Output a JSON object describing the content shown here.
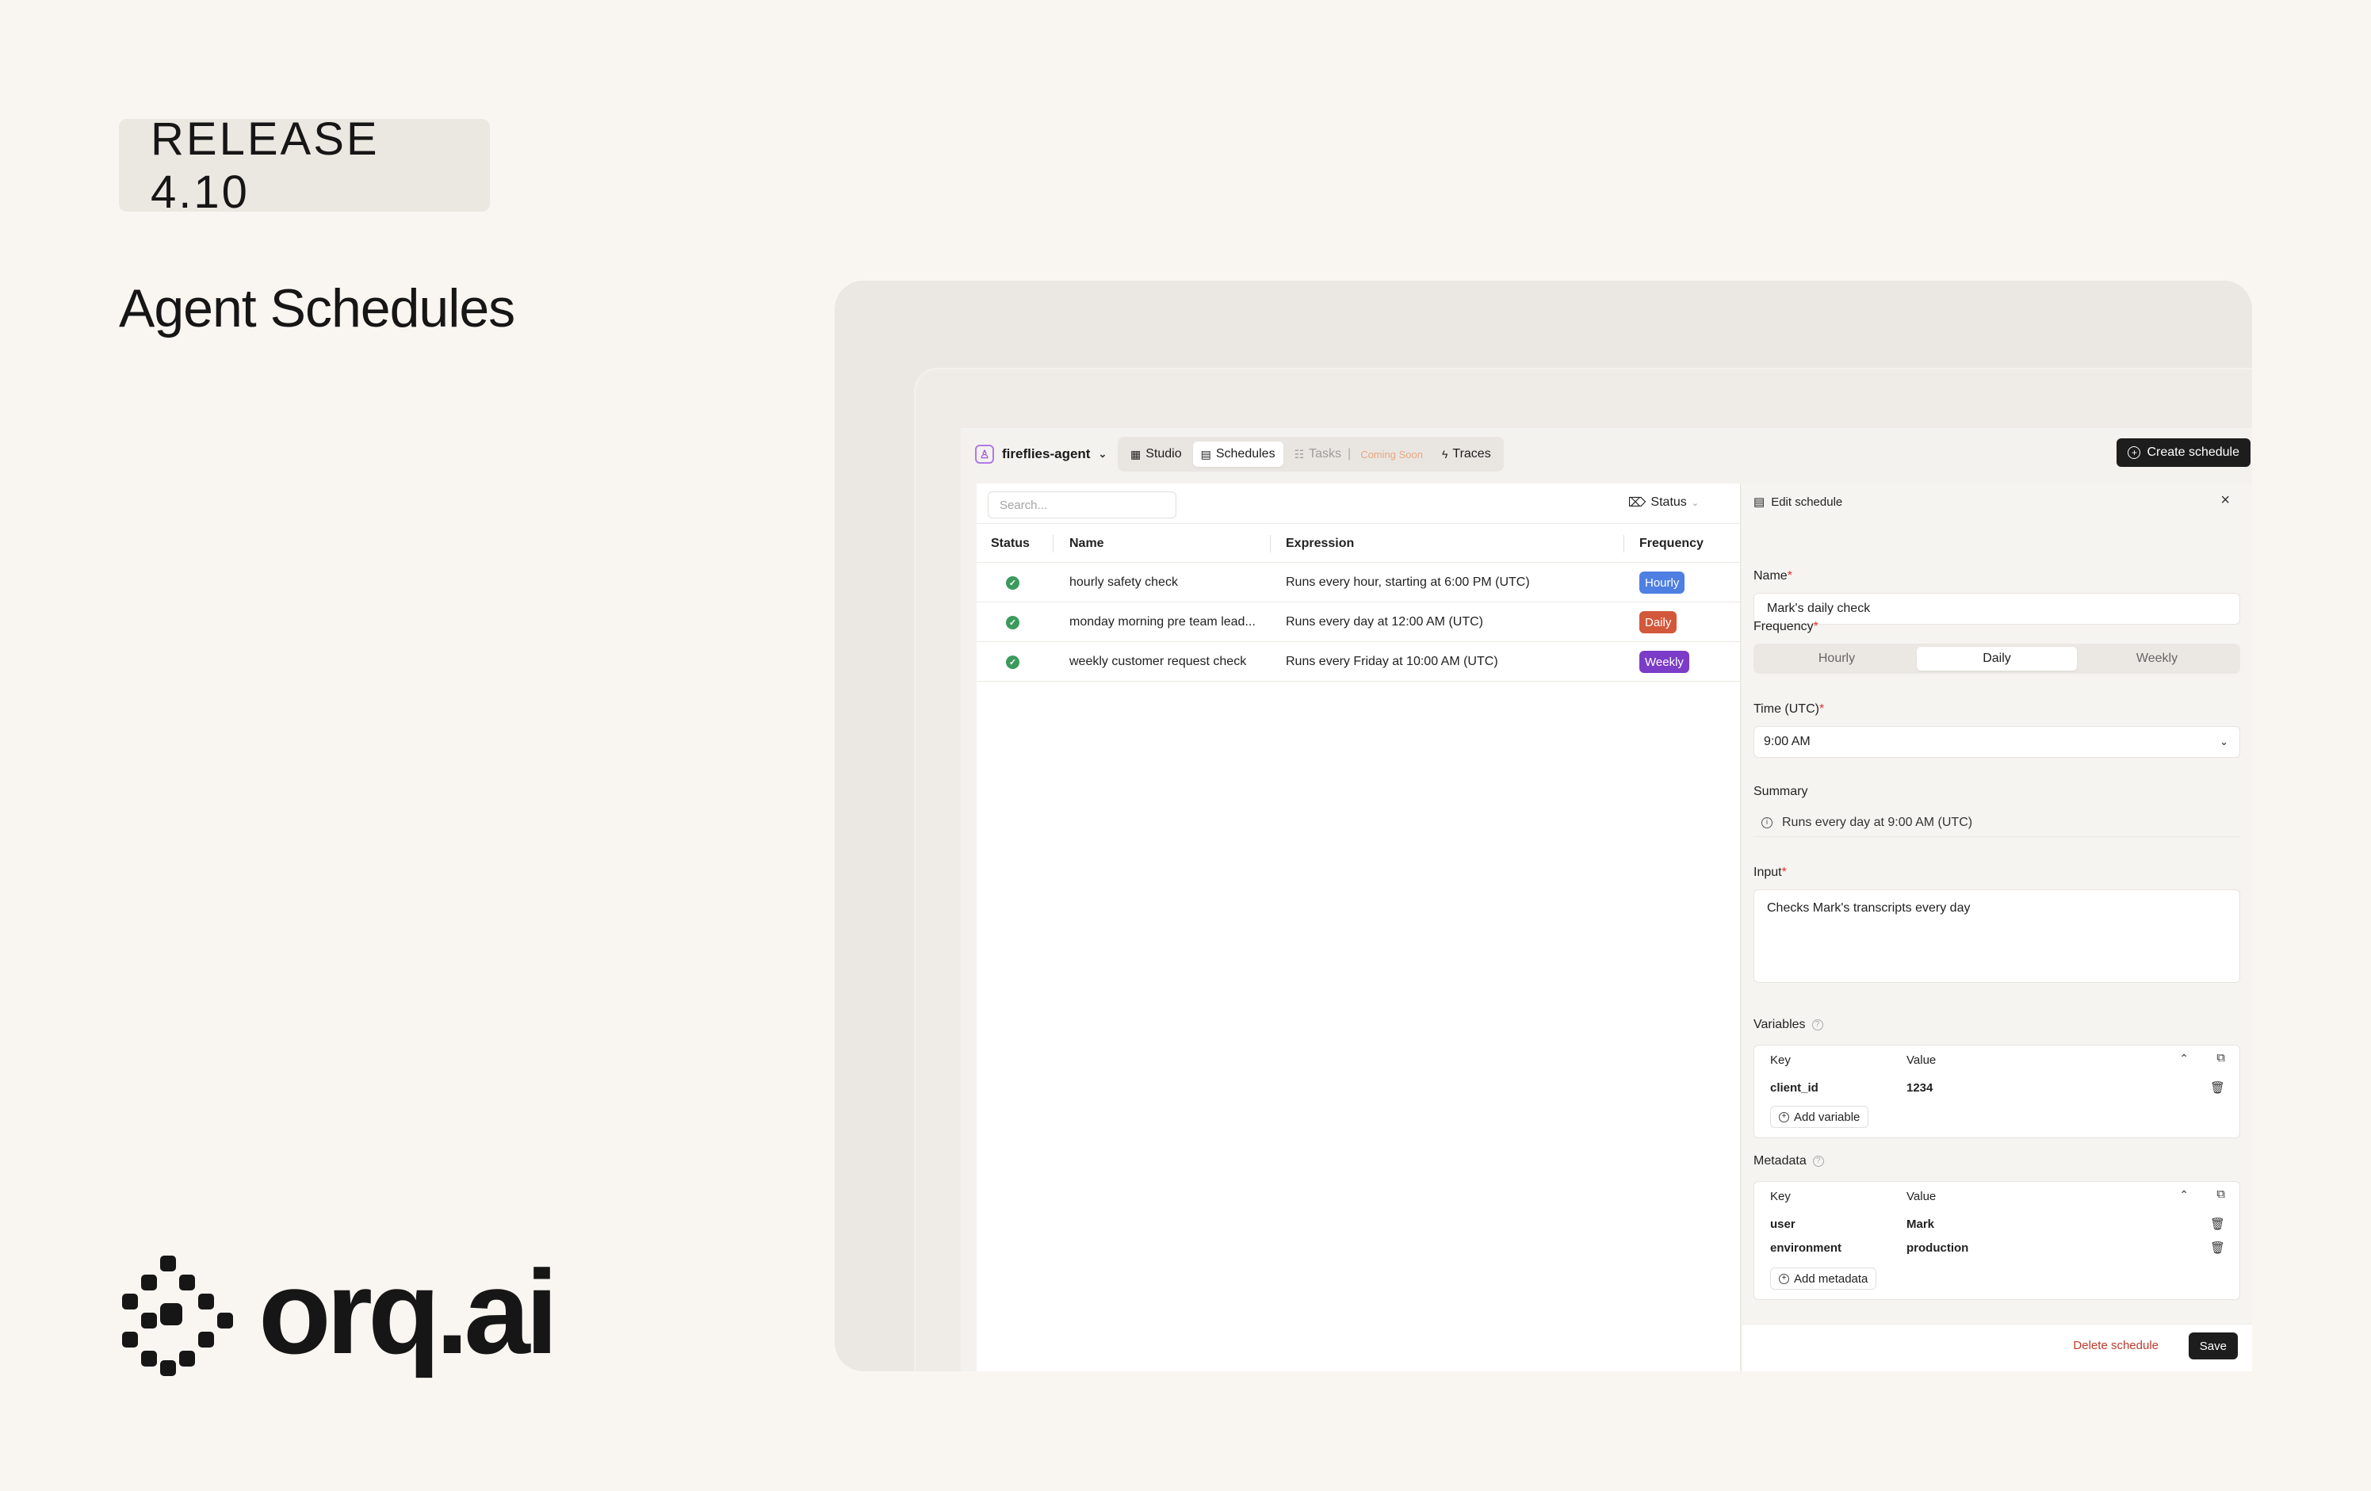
{
  "release": "RELEASE 4.10",
  "hero_title": "Agent Schedules",
  "brand": {
    "logo_text": "orq.ai",
    "accent": "#161616"
  },
  "app": {
    "agent_name": "fireflies-agent",
    "tabs": [
      {
        "label": "Studio",
        "icon": "grid-icon"
      },
      {
        "label": "Schedules",
        "icon": "calendar-icon",
        "active": true
      },
      {
        "label": "Tasks",
        "icon": "list-icon",
        "disabled": true,
        "note": "Coming Soon"
      },
      {
        "label": "Traces",
        "icon": "bolt-icon"
      }
    ],
    "create_button": "Create schedule"
  },
  "list": {
    "search_placeholder": "Search...",
    "status_filter": "Status",
    "columns": [
      "Status",
      "Name",
      "Expression",
      "Frequency"
    ],
    "rows": [
      {
        "name": "hourly safety check",
        "expression": "Runs every hour, starting at 6:00 PM (UTC)",
        "frequency": "Hourly"
      },
      {
        "name": "monday morning pre team lead...",
        "expression": "Runs every day at 12:00 AM (UTC)",
        "frequency": "Daily"
      },
      {
        "name": "weekly customer request check",
        "expression": "Runs every Friday at 10:00 AM (UTC)",
        "frequency": "Weekly"
      }
    ],
    "colors": {
      "Hourly": "#4e7fe3",
      "Daily": "#d3573a",
      "Weekly": "#7b3cc7",
      "status_ok": "#3b9a5c"
    }
  },
  "edit": {
    "title": "Edit schedule",
    "name_label": "Name",
    "name_value": "Mark's daily check",
    "frequency_label": "Frequency",
    "frequency_options": [
      "Hourly",
      "Daily",
      "Weekly"
    ],
    "frequency_selected": "Daily",
    "time_label": "Time (UTC)",
    "time_value": "9:00 AM",
    "summary_label": "Summary",
    "summary_value": "Runs every day at 9:00 AM (UTC)",
    "input_label": "Input",
    "input_value": "Checks Mark's transcripts every day",
    "variables_label": "Variables",
    "kv_key_header": "Key",
    "kv_value_header": "Value",
    "variables": [
      {
        "key": "client_id",
        "value": "1234"
      }
    ],
    "add_variable": "Add variable",
    "metadata_label": "Metadata",
    "metadata": [
      {
        "key": "user",
        "value": "Mark"
      },
      {
        "key": "environment",
        "value": "production"
      }
    ],
    "add_metadata": "Add metadata",
    "delete_label": "Delete schedule",
    "save_label": "Save"
  }
}
